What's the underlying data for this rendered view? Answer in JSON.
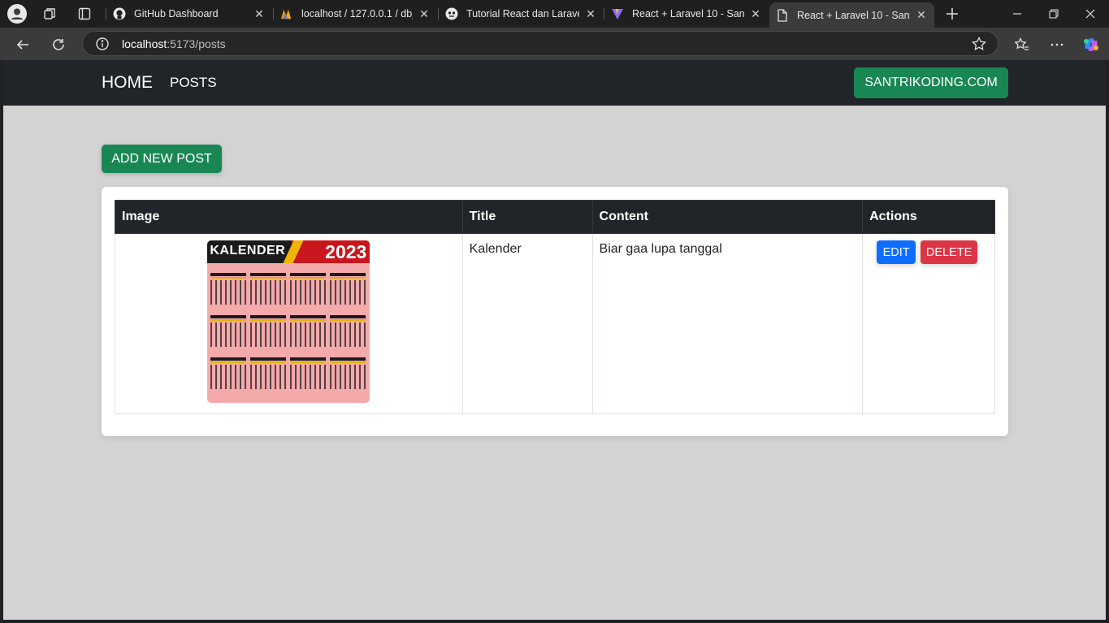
{
  "browser": {
    "tabs": [
      {
        "title": "GitHub Dashboard",
        "favicon": "github-icon"
      },
      {
        "title": "localhost / 127.0.0.1 / db_la",
        "favicon": "phpmyadmin-icon"
      },
      {
        "title": "Tutorial React dan Laravel",
        "favicon": "forum-icon"
      },
      {
        "title": "React + Laravel 10 - Santri",
        "favicon": "vite-icon"
      },
      {
        "title": "React + Laravel 10 - Santri",
        "favicon": "page-icon",
        "active": true
      }
    ],
    "address": {
      "host": "localhost",
      "path": ":5173/posts"
    }
  },
  "navbar": {
    "brand": "HOME",
    "links": [
      "POSTS"
    ],
    "cta_label": "SANTRIKODING.COM"
  },
  "actions": {
    "add_label": "ADD NEW POST"
  },
  "table": {
    "headers": [
      "Image",
      "Title",
      "Content",
      "Actions"
    ],
    "rows": [
      {
        "image_caption": "KALENDER",
        "image_year": "2023",
        "title": "Kalender",
        "content": "Biar gaa lupa tanggal",
        "edit_label": "EDIT",
        "delete_label": "DELETE"
      }
    ]
  },
  "colors": {
    "navbar_bg": "#212529",
    "success": "#198754",
    "primary": "#0d6efd",
    "danger": "#dc3545",
    "page_bg": "#d3d3d3"
  }
}
